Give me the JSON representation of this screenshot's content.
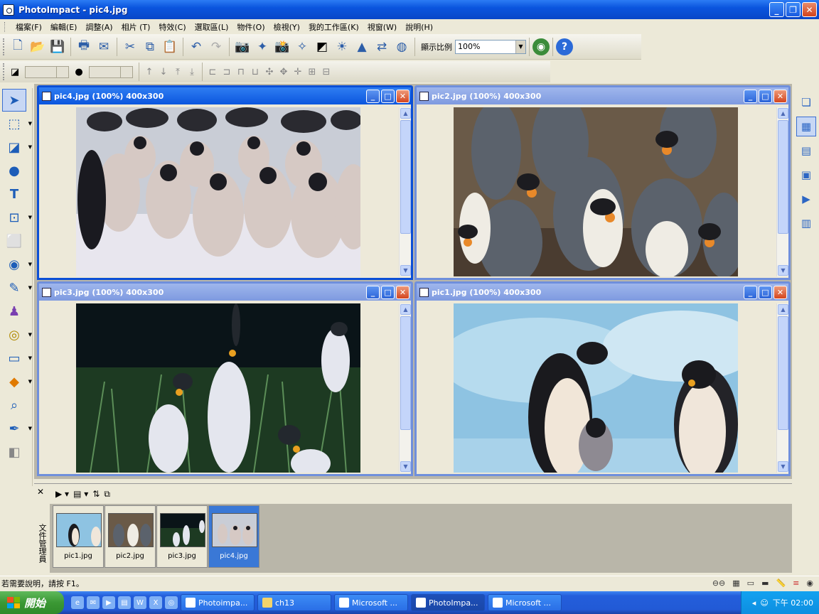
{
  "app": {
    "title": "PhotoImpact - pic4.jpg"
  },
  "menu": [
    "檔案(F)",
    "編輯(E)",
    "調整(A)",
    "相片 (T)",
    "特效(C)",
    "選取區(L)",
    "物件(O)",
    "檢視(Y)",
    "我的工作區(K)",
    "視窗(W)",
    "說明(H)"
  ],
  "toolbar": {
    "zoom_label": "顯示比例",
    "zoom_value": "100%"
  },
  "documents": [
    {
      "title": "pic4.jpg (100%) 400x300",
      "active": true
    },
    {
      "title": "pic2.jpg (100%) 400x300",
      "active": false
    },
    {
      "title": "pic3.jpg (100%) 400x300",
      "active": false
    },
    {
      "title": "pic1.jpg (100%) 400x300",
      "active": false
    }
  ],
  "doc_manager": {
    "side_label": "文件管理員",
    "thumbnails": [
      {
        "name": "pic1.jpg",
        "selected": false
      },
      {
        "name": "pic2.jpg",
        "selected": false
      },
      {
        "name": "pic3.jpg",
        "selected": false
      },
      {
        "name": "pic4.jpg",
        "selected": true
      }
    ]
  },
  "status": {
    "text": "若需要說明，請按 F1。"
  },
  "taskbar": {
    "start_label": "開始",
    "tasks": [
      {
        "label": "Photoimpa...",
        "active": false
      },
      {
        "label": "ch13",
        "active": false
      },
      {
        "label": "Microsoft ...",
        "active": false
      },
      {
        "label": "PhotoImpa...",
        "active": true
      },
      {
        "label": "Microsoft ...",
        "active": false
      }
    ],
    "clock": "下午 02:00"
  },
  "colors": {
    "title_active": "#0b55de",
    "title_inactive": "#7e9ae0",
    "accent": "#3a78d6"
  }
}
